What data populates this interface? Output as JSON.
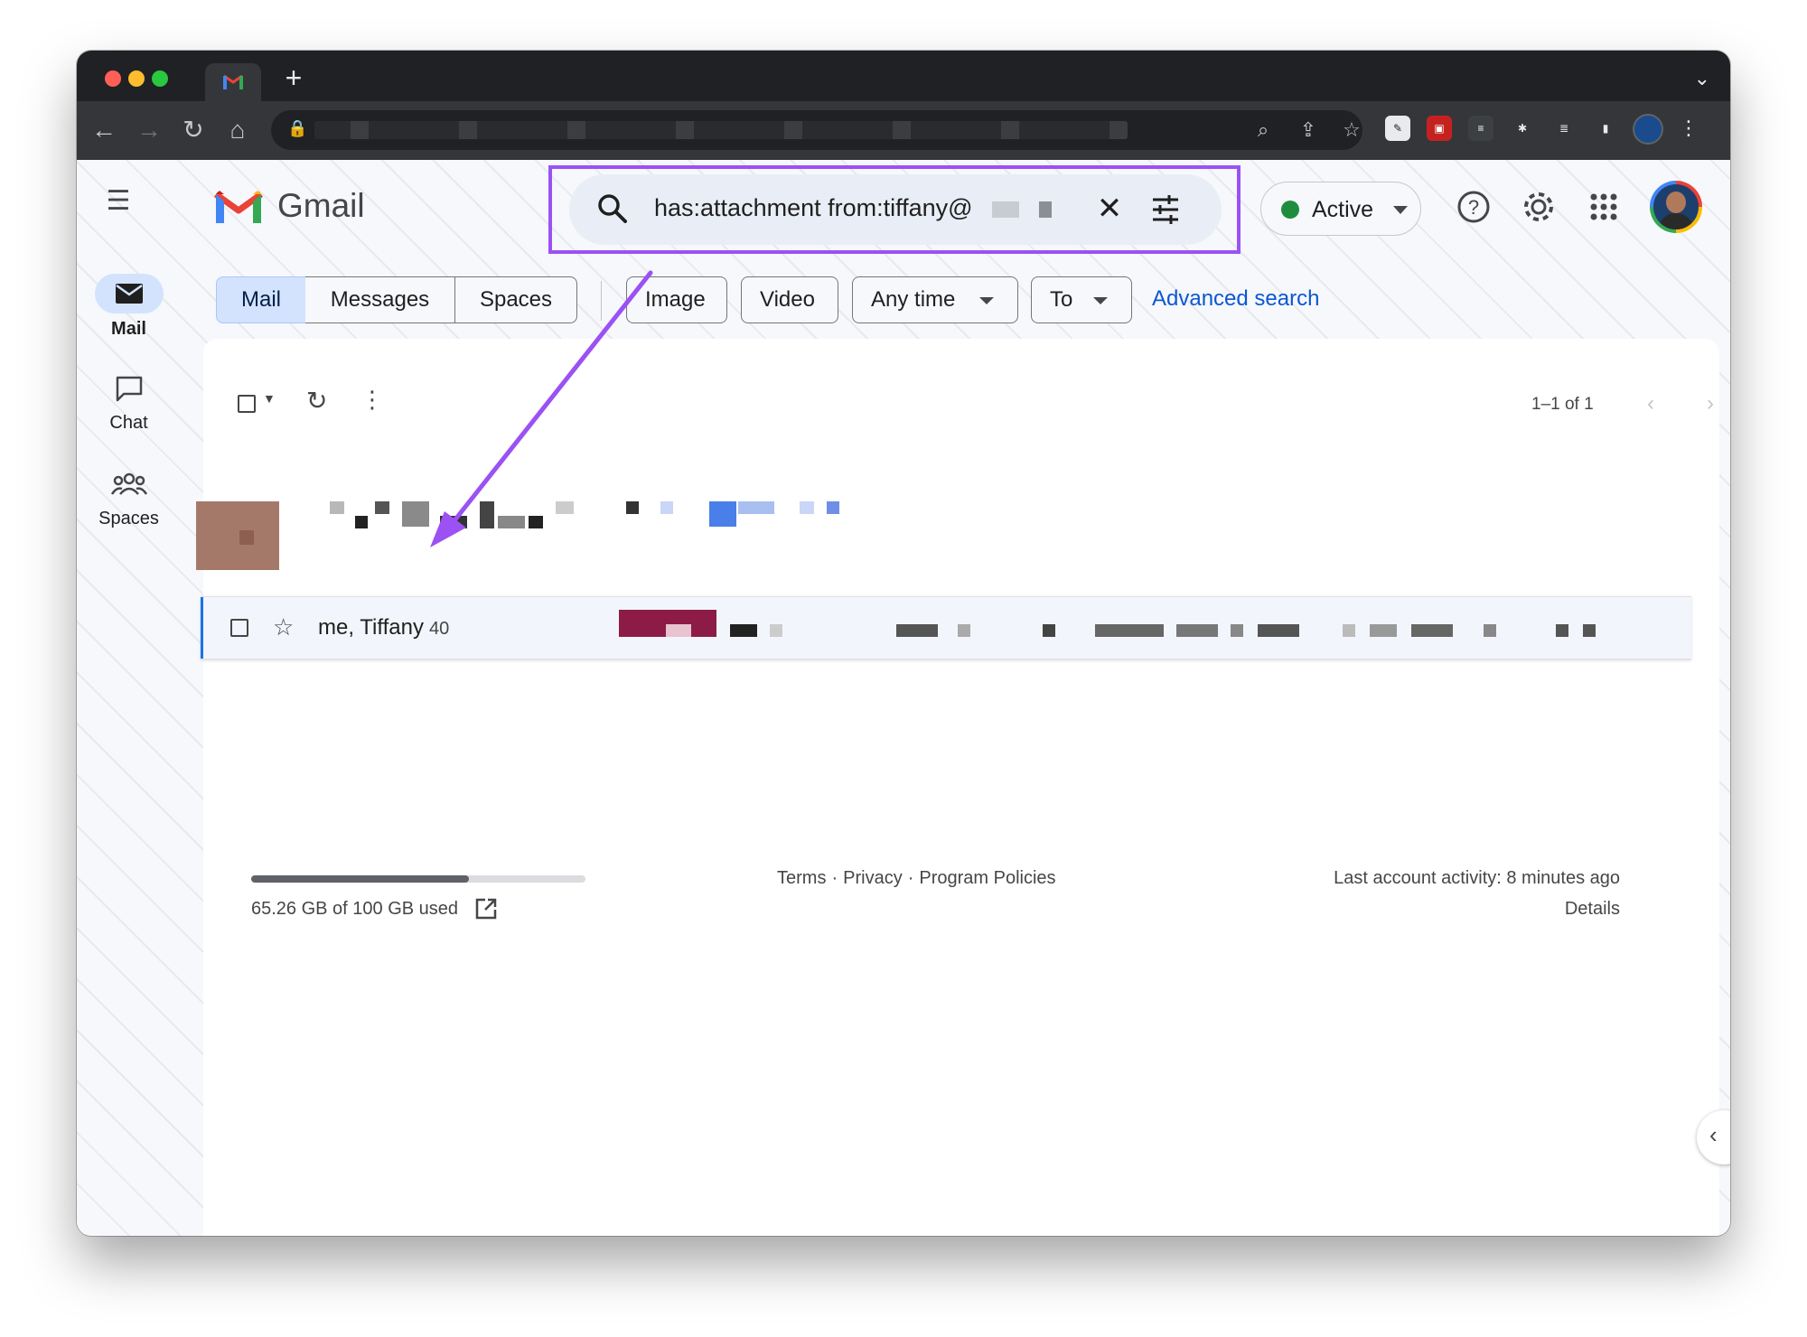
{
  "header": {
    "app_name": "Gmail",
    "search_query": "has:attachment from:tiffany@",
    "status_label": "Active"
  },
  "rail": {
    "items": [
      {
        "label": "Mail",
        "icon": "mail-icon",
        "active": true
      },
      {
        "label": "Chat",
        "icon": "chat-icon",
        "active": false
      },
      {
        "label": "Spaces",
        "icon": "spaces-icon",
        "active": false
      }
    ]
  },
  "filters": {
    "segments": [
      "Mail",
      "Messages",
      "Spaces"
    ],
    "chips": [
      "Image",
      "Video",
      "Any time",
      "To"
    ],
    "advanced_search": "Advanced search"
  },
  "list": {
    "pagination": "1–1 of 1",
    "rows": [
      {
        "sender": "me, Tiffany",
        "count": "40"
      }
    ]
  },
  "footer": {
    "storage_text": "65.26 GB of 100 GB used",
    "storage_fraction": 0.6526,
    "links": [
      "Terms",
      "Privacy",
      "Program Policies"
    ],
    "activity": "Last account activity: 8 minutes ago",
    "details": "Details"
  },
  "colors": {
    "annotation": "#9b51f3",
    "accent": "#0b57d0",
    "active_status": "#1e8e3e"
  }
}
